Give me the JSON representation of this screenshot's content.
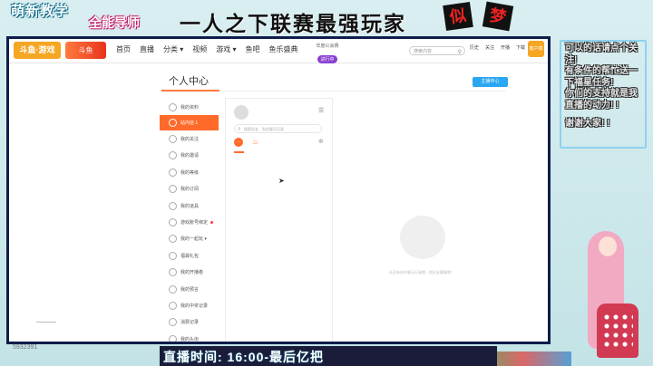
{
  "overlay": {
    "top_left_line1": "萌新教学",
    "top_left_line2": "全能导师",
    "banner_title": "一人之下联赛最强玩家",
    "stamp1": "似",
    "stamp2": "梦",
    "comment_lines": [
      "可以的话请点个关注!",
      "有条件的帮忙送一下福星任务!",
      "你们的支持就是我直播的动力! !",
      "",
      "谢谢大家! !"
    ],
    "bottom_text": "直播时间: 16:00-最后亿把",
    "uid_text": "5932391"
  },
  "site": {
    "logo": "斗鱼·游戏",
    "logo2": "斗鱼",
    "nav": [
      "首页",
      "直播",
      "分类 ▾",
      "视频",
      "游戏 ▾",
      "鱼吧",
      "鱼乐盛典"
    ],
    "promo_title": "年度公会赛",
    "promo_badge": "进行中",
    "search_placeholder": "搜索内容",
    "top_icons": [
      "历史",
      "关注",
      "开播",
      "下载"
    ],
    "avatar_label": "客户端"
  },
  "page": {
    "title": "个人中心",
    "anchor_button": "主播中心",
    "sidebar": [
      {
        "label": "我的资料",
        "active": false,
        "dot": false
      },
      {
        "label": "站内信 1",
        "active": true,
        "dot": false
      },
      {
        "label": "我的关注",
        "active": false,
        "dot": false
      },
      {
        "label": "我的邀请",
        "active": false,
        "dot": false
      },
      {
        "label": "我的等级",
        "active": false,
        "dot": false
      },
      {
        "label": "我的订阅",
        "active": false,
        "dot": false
      },
      {
        "label": "我的道具",
        "active": false,
        "dot": false
      },
      {
        "label": "游戏账号绑定",
        "active": false,
        "dot": true
      },
      {
        "label": "我的一起玩 ▾",
        "active": false,
        "dot": false
      },
      {
        "label": "福袋礼包",
        "active": false,
        "dot": false
      },
      {
        "label": "我的开播卷",
        "active": false,
        "dot": false
      },
      {
        "label": "我的预言",
        "active": false,
        "dot": false
      },
      {
        "label": "我的中奖记录",
        "active": false,
        "dot": false
      },
      {
        "label": "消费记录",
        "active": false,
        "dot": false
      },
      {
        "label": "我的头衔",
        "active": false,
        "dot": false
      }
    ],
    "msg_search_placeholder": "搜索好友、私信聊天记录",
    "empty_text": "还没有选中聊天记录哦，找好友聊聊吧！"
  }
}
